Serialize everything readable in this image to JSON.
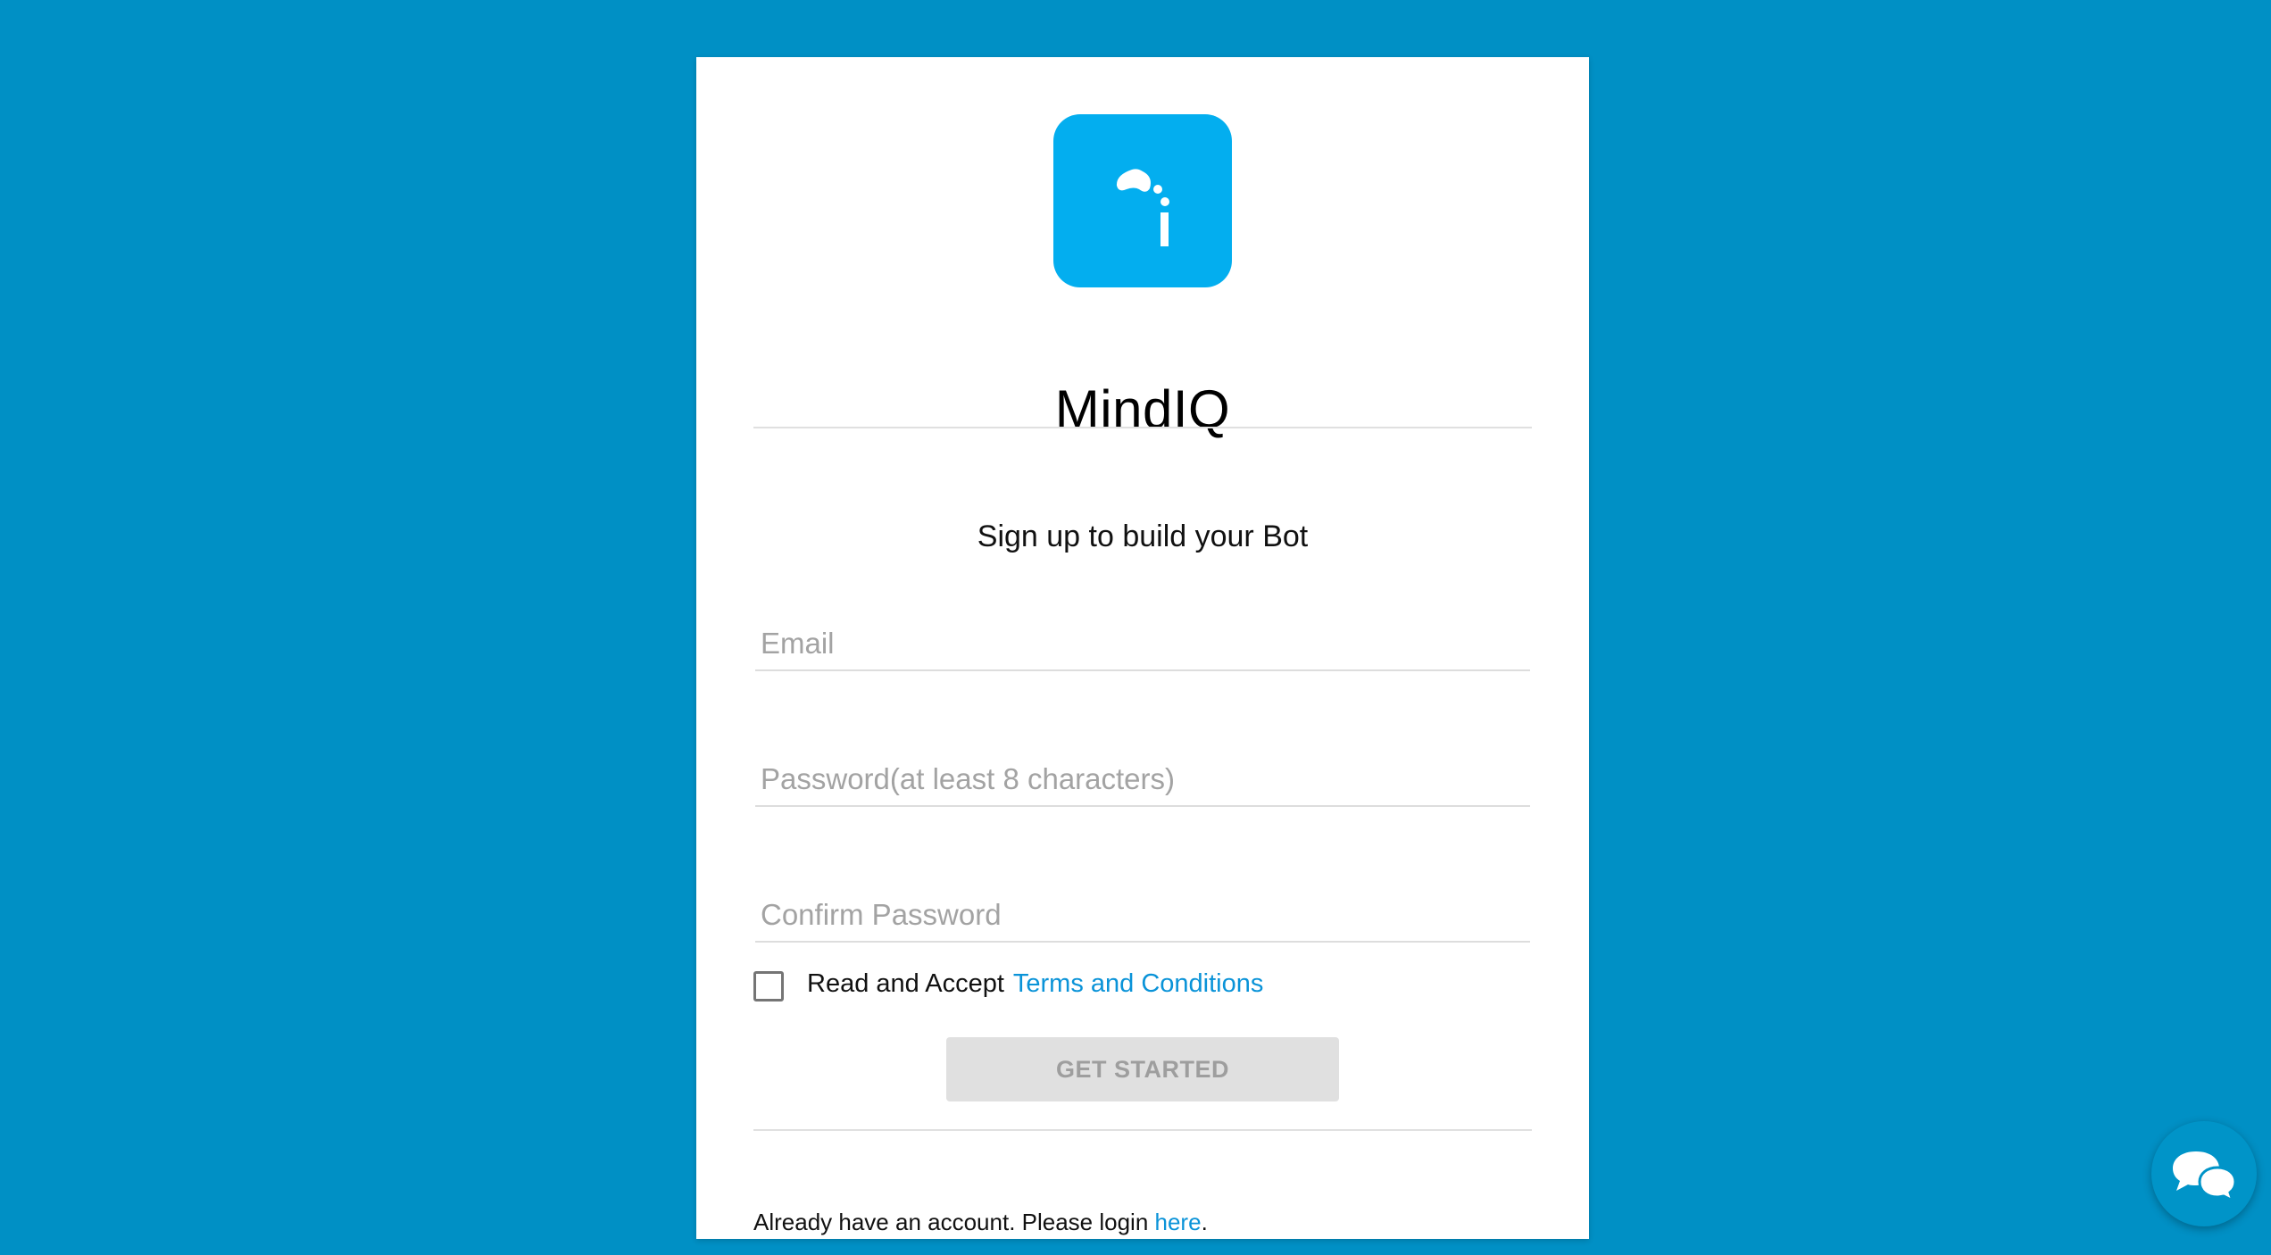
{
  "app": {
    "title": "MindIQ",
    "logo_icon": "mindiq-logo-icon",
    "accent_color": "#03aeef",
    "background_color": "#0090c5",
    "link_color": "#0a93d8"
  },
  "signup": {
    "subtitle": "Sign up to build your Bot",
    "email_placeholder": "Email",
    "email_value": "",
    "password_placeholder": "Password(at least 8 characters)",
    "password_value": "",
    "confirm_placeholder": "Confirm Password",
    "confirm_value": "",
    "terms_checked": false,
    "terms_text": "Read and Accept",
    "terms_link": "Terms and Conditions",
    "submit_label": "GET STARTED",
    "submit_enabled": false
  },
  "login_prompt": {
    "text": "Already have an account. Please login ",
    "link": "here",
    "suffix": "."
  },
  "chat_widget": {
    "icon": "chat-bubbles-icon"
  }
}
